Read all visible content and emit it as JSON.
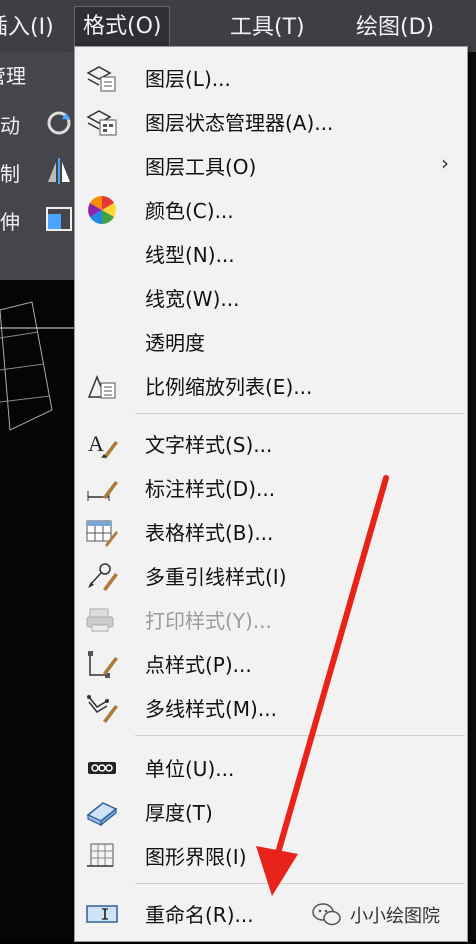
{
  "menubar": {
    "items": [
      {
        "label": "插入(I)"
      },
      {
        "label": "格式(O)"
      },
      {
        "label": "工具(T)"
      },
      {
        "label": "绘图(D)"
      }
    ]
  },
  "ribbon": {
    "tab": "管理",
    "rows": [
      {
        "label": "移动"
      },
      {
        "label": "复制"
      },
      {
        "label": "拉伸"
      }
    ]
  },
  "format_menu": {
    "items": [
      {
        "label": "图层(L)...",
        "icon": "layer-icon"
      },
      {
        "label": "图层状态管理器(A)...",
        "icon": "layer-state-icon"
      },
      {
        "label": "图层工具(O)",
        "icon": "",
        "submenu": "›"
      },
      {
        "label": "颜色(C)...",
        "icon": "color-wheel-icon"
      },
      {
        "label": "线型(N)...",
        "icon": ""
      },
      {
        "label": "线宽(W)...",
        "icon": ""
      },
      {
        "label": "透明度",
        "icon": ""
      },
      {
        "label": "比例缩放列表(E)...",
        "icon": "scale-list-icon"
      },
      {
        "label": "文字样式(S)...",
        "icon": "text-style-icon"
      },
      {
        "label": "标注样式(D)...",
        "icon": "dim-style-icon"
      },
      {
        "label": "表格样式(B)...",
        "icon": "table-style-icon"
      },
      {
        "label": "多重引线样式(I)",
        "icon": "mleader-style-icon"
      },
      {
        "label": "打印样式(Y)...",
        "icon": "plot-style-icon",
        "disabled": true
      },
      {
        "label": "点样式(P)...",
        "icon": "point-style-icon"
      },
      {
        "label": "多线样式(M)...",
        "icon": "mline-style-icon"
      },
      {
        "label": "单位(U)...",
        "icon": "units-icon"
      },
      {
        "label": "厚度(T)",
        "icon": "thickness-icon"
      },
      {
        "label": "图形界限(I)",
        "icon": "drawing-limits-icon"
      },
      {
        "label": "重命名(R)...",
        "icon": "rename-icon"
      }
    ]
  },
  "watermark": {
    "text": "小小绘图院"
  },
  "colors": {
    "annotation_arrow": "#e8231b",
    "menu_bg": "#f2f2f2",
    "menubar_bg": "#3e3f45"
  }
}
